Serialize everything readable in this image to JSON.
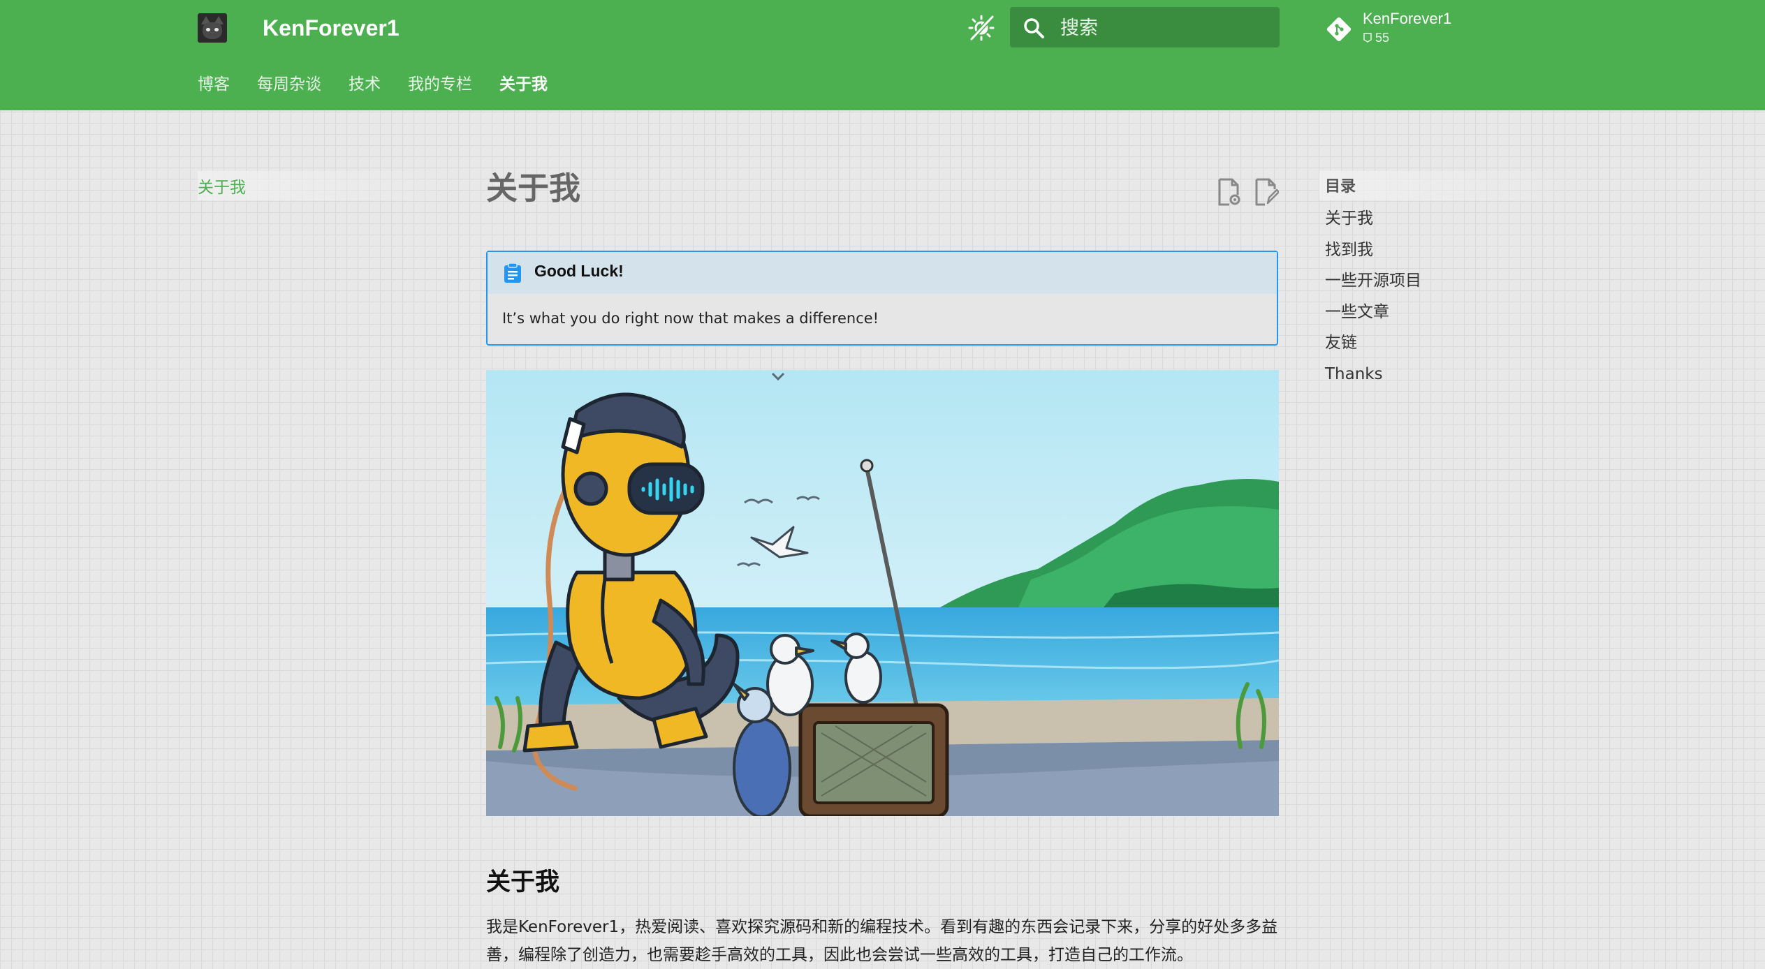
{
  "header": {
    "site_title": "KenForever1",
    "search_placeholder": "搜索",
    "repo": {
      "name": "KenForever1",
      "stat": "55"
    }
  },
  "nav": {
    "tabs": [
      {
        "label": "博客"
      },
      {
        "label": "每周杂谈"
      },
      {
        "label": "技术"
      },
      {
        "label": "我的专栏"
      },
      {
        "label": "关于我"
      }
    ]
  },
  "sidebar": {
    "current": "关于我"
  },
  "main": {
    "title": "关于我",
    "admonition": {
      "title": "Good Luck!",
      "body": "It’s what you do right now that makes a difference!"
    },
    "section_heading": "关于我",
    "intro": "我是KenForever1，热爱阅读、喜欢探究源码和新的编程技术。看到有趣的东西会记录下来，分享的好处多多益善，编程除了创造力，也需要趁手高效的工具，因此也会尝试一些高效的工具，打造自己的工作流。"
  },
  "toc": {
    "title": "目录",
    "items": [
      "关于我",
      "找到我",
      "一些开源项目",
      "一些文章",
      "友链",
      "Thanks"
    ]
  },
  "colors": {
    "primary": "#4caf50",
    "accent_blue": "#2196f3",
    "admonition_head": "#d4e2ec"
  },
  "icons": {
    "logo": "cat-avatar-logo",
    "theme": "theme-toggle-icon",
    "search": "search-icon",
    "repo": "git-icon",
    "view_source": "view-source-icon",
    "edit": "edit-page-icon",
    "admonition": "clipboard-icon"
  }
}
